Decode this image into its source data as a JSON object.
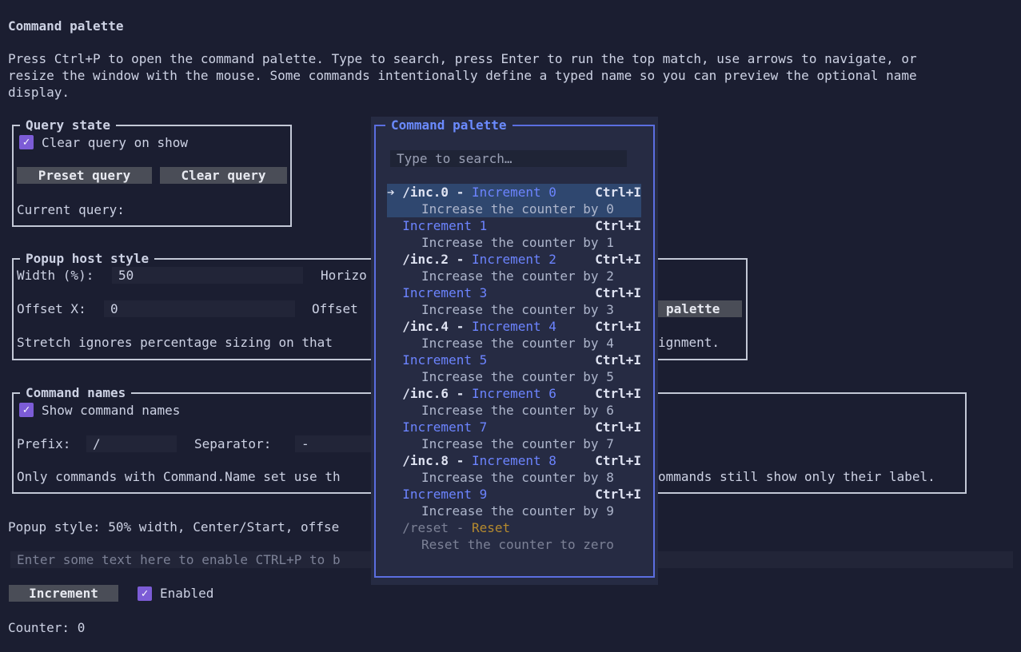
{
  "title": "Command palette",
  "intro": [
    "Press Ctrl+P to open the command palette. Type to search, press Enter to run the top match, use arrows to navigate, or",
    "resize the window with the mouse. Some commands intentionally define a typed name so you can preview the optional name",
    "display."
  ],
  "query_state": {
    "legend": "Query state",
    "clear_on_show_label": "Clear query on show",
    "clear_on_show_checked": true,
    "preset_button": "Preset query",
    "clear_button": "Clear query",
    "current_query_label": "Current query:"
  },
  "popup_host": {
    "legend": "Popup host style",
    "width_label": "Width (%):",
    "width_value": "50",
    "horizontal_label": "Horizo",
    "offset_x_label": "Offset X:",
    "offset_x_value": "0",
    "offset_y_label": "Offset",
    "open_button_partial": "palette",
    "note_left": "Stretch ignores percentage sizing on that",
    "note_right": "ignment."
  },
  "command_names": {
    "legend": "Command names",
    "show_label": "Show command names",
    "show_checked": true,
    "prefix_label": "Prefix:",
    "prefix_value": "/",
    "separator_label": "Separator:",
    "separator_value": "-",
    "note_left": "Only commands with Command.Name set use th",
    "note_right": "ommands still show only their label."
  },
  "popup_style_text": "Popup style: 50% width, Center/Start, offse",
  "text_input_placeholder": "Enter some text here to enable CTRL+P to b",
  "increment_button": "Increment",
  "enabled_label": "Enabled",
  "enabled_checked": true,
  "counter_text": "Counter: 0",
  "palette": {
    "title": "Command palette",
    "search_placeholder": "Type to search…",
    "selected_marker": "➔",
    "items": [
      {
        "name": "/inc.0 - ",
        "label": "Increment 0",
        "shortcut": "Ctrl+I",
        "desc": "Increase the counter by 0"
      },
      {
        "name": "",
        "label": "Increment 1",
        "shortcut": "Ctrl+I",
        "desc": "Increase the counter by 1"
      },
      {
        "name": "/inc.2 - ",
        "label": "Increment 2",
        "shortcut": "Ctrl+I",
        "desc": "Increase the counter by 2"
      },
      {
        "name": "",
        "label": "Increment 3",
        "shortcut": "Ctrl+I",
        "desc": "Increase the counter by 3"
      },
      {
        "name": "/inc.4 - ",
        "label": "Increment 4",
        "shortcut": "Ctrl+I",
        "desc": "Increase the counter by 4"
      },
      {
        "name": "",
        "label": "Increment 5",
        "shortcut": "Ctrl+I",
        "desc": "Increase the counter by 5"
      },
      {
        "name": "/inc.6 - ",
        "label": "Increment 6",
        "shortcut": "Ctrl+I",
        "desc": "Increase the counter by 6"
      },
      {
        "name": "",
        "label": "Increment 7",
        "shortcut": "Ctrl+I",
        "desc": "Increase the counter by 7"
      },
      {
        "name": "/inc.8 - ",
        "label": "Increment 8",
        "shortcut": "Ctrl+I",
        "desc": "Increase the counter by 8"
      },
      {
        "name": "",
        "label": "Increment 9",
        "shortcut": "Ctrl+I",
        "desc": "Increase the counter by 9"
      },
      {
        "name": "/reset - ",
        "label": "Reset",
        "shortcut": "",
        "desc": "Reset the counter to zero",
        "disabled": true
      }
    ]
  },
  "colors": {
    "background": "#1b1e31",
    "palette_accent": "#6c84ff",
    "selected_row": "#2f476f",
    "checkbox": "#7c5cd6",
    "disabled_label": "#b58a2e"
  }
}
